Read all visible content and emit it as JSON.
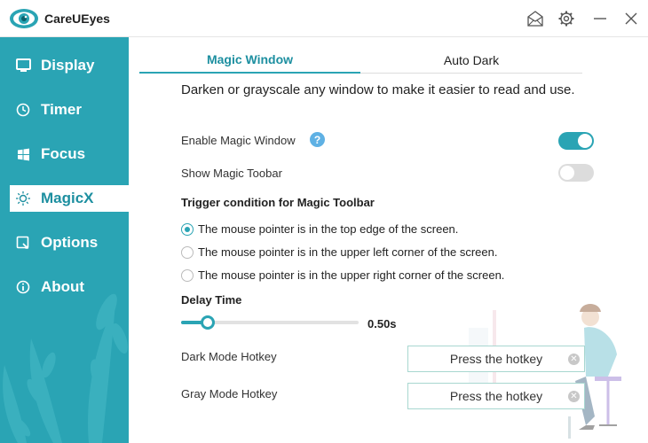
{
  "app": {
    "title": "CareUEyes"
  },
  "colors": {
    "accent": "#2aa4b4",
    "sidebar": "#2aa4b4",
    "help": "#5fb1e4"
  },
  "titlebar_icons": [
    "mail-icon",
    "gear-icon",
    "minimize-icon",
    "close-icon"
  ],
  "sidebar": {
    "items": [
      {
        "label": "Display",
        "icon": "monitor-icon",
        "active": false
      },
      {
        "label": "Timer",
        "icon": "clock-icon",
        "active": false
      },
      {
        "label": "Focus",
        "icon": "windows-icon",
        "active": false
      },
      {
        "label": "MagicX",
        "icon": "sun-icon",
        "active": true
      },
      {
        "label": "Options",
        "icon": "options-icon",
        "active": false
      },
      {
        "label": "About",
        "icon": "info-icon",
        "active": false
      }
    ]
  },
  "tabs": [
    {
      "label": "Magic Window",
      "active": true
    },
    {
      "label": "Auto Dark",
      "active": false
    }
  ],
  "main": {
    "description": "Darken or grayscale any window to make it easier to read and use.",
    "enable_magic_window": {
      "label": "Enable Magic Window",
      "on": true
    },
    "show_magic_toolbar": {
      "label": "Show Magic Toobar",
      "on": false
    },
    "trigger_title": "Trigger condition for Magic Toolbar",
    "trigger_options": [
      {
        "label": "The mouse pointer is in the top edge of the screen.",
        "checked": true
      },
      {
        "label": "The mouse pointer is in the upper left corner of the screen.",
        "checked": false
      },
      {
        "label": "The mouse pointer is in the upper right corner of the screen.",
        "checked": false
      }
    ],
    "delay": {
      "title": "Delay Time",
      "value_label": "0.50s",
      "fraction": 0.15
    },
    "dark_hotkey": {
      "label": "Dark Mode Hotkey",
      "placeholder": "Press the hotkey"
    },
    "gray_hotkey": {
      "label": "Gray Mode Hotkey",
      "placeholder": "Press the hotkey"
    }
  }
}
